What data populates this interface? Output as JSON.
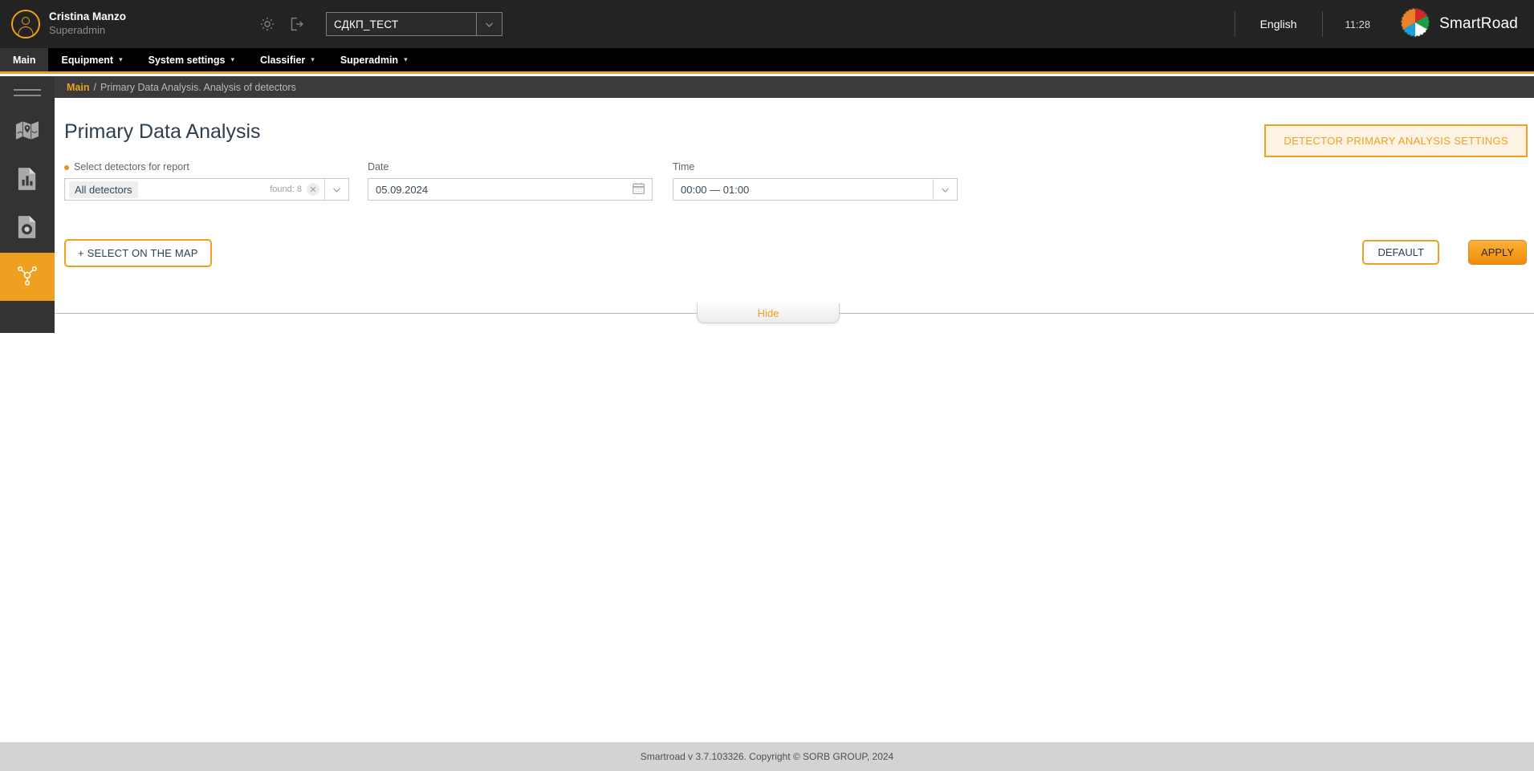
{
  "header": {
    "user_name": "Cristina Manzo",
    "user_role": "Superadmin",
    "avatar_icon": "user-avatar-icon",
    "settings_icon": "gear-icon",
    "logout_icon": "logout-icon",
    "project": {
      "value": "СДКП_ТЕСТ",
      "arrow_icon": "chevron-down-icon"
    },
    "language": "English",
    "time": "11:28",
    "brand": "SmartRoad",
    "logo_icon": "smartroad-gear-logo",
    "logo_colors": [
      "#e8832a",
      "#d62828",
      "#1e9e4a",
      "#ffffff",
      "#1f9fd8"
    ]
  },
  "nav": {
    "items": [
      {
        "label": "Main",
        "active": true,
        "has_caret": false
      },
      {
        "label": "Equipment",
        "active": false,
        "has_caret": true
      },
      {
        "label": "System settings",
        "active": false,
        "has_caret": true
      },
      {
        "label": "Classifier",
        "active": false,
        "has_caret": true
      },
      {
        "label": "Superadmin",
        "active": false,
        "has_caret": true
      }
    ],
    "caret_icon": "chevron-down-icon",
    "accent_color": "#f0a020"
  },
  "sidebar": {
    "burger_icon": "hamburger-menu-icon",
    "items": [
      {
        "icon": "map-icon",
        "active": false
      },
      {
        "icon": "bar-chart-report-icon",
        "active": false
      },
      {
        "icon": "camera-detector-icon",
        "active": false
      },
      {
        "icon": "network-node-icon",
        "active": true
      }
    ]
  },
  "breadcrumb": {
    "root": "Main",
    "separator": "/",
    "current": "Primary Data Analysis. Analysis of detectors"
  },
  "main": {
    "page_title": "Primary Data Analysis",
    "settings_button": "DETECTOR PRIMARY ANALYSIS SETTINGS",
    "fields": {
      "detectors": {
        "label": "Select detectors for report",
        "required": true,
        "chip_value": "All detectors",
        "found_text": "found: 8",
        "clear_icon": "close-circle-icon",
        "arrow_icon": "chevron-down-icon"
      },
      "date": {
        "label": "Date",
        "value": "05.09.2024",
        "calendar_icon": "calendar-icon"
      },
      "time": {
        "label": "Time",
        "value": "00:00 — 01:00",
        "arrow_icon": "chevron-down-icon"
      }
    },
    "buttons": {
      "select_on_map": "+ SELECT ON THE MAP",
      "default": "DEFAULT",
      "apply": "APPLY"
    },
    "hide_tab": "Hide"
  },
  "footer": {
    "text": "Smartroad v 3.7.103326. Copyright © SORB GROUP, 2024"
  },
  "colors": {
    "accent": "#f0a020",
    "header_bg": "#232323",
    "nav_bg": "#000000",
    "sidebar_bg": "#333333",
    "footer_bg": "#d3d3d3"
  }
}
